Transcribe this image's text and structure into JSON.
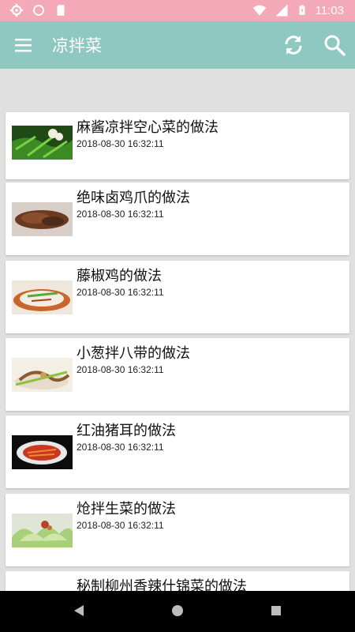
{
  "status_bar": {
    "time": "11:03",
    "icons_left": [
      "gear-icon",
      "circle-icon",
      "sd-card-icon"
    ],
    "icons_right": [
      "wifi-icon",
      "signal-icon",
      "battery-icon"
    ]
  },
  "app_bar": {
    "title": "凉拌菜",
    "icons": [
      "menu-icon",
      "refresh-icon",
      "search-icon"
    ]
  },
  "recipes": [
    {
      "title": "麻酱凉拌空心菜的做法",
      "date": "2018-08-30 16:32:11"
    },
    {
      "title": "绝味卤鸡爪的做法",
      "date": "2018-08-30 16:32:11"
    },
    {
      "title": "藤椒鸡的做法",
      "date": "2018-08-30 16:32:11"
    },
    {
      "title": "小葱拌八带的做法",
      "date": "2018-08-30 16:32:11"
    },
    {
      "title": "红油猪耳的做法",
      "date": "2018-08-30 16:32:11"
    },
    {
      "title": "炝拌生菜的做法",
      "date": "2018-08-30 16:32:11"
    },
    {
      "title": "秘制柳州香辣什锦菜的做法",
      "date": ""
    }
  ],
  "nav_bar": {
    "icons": [
      "back-icon",
      "home-icon",
      "recents-icon"
    ]
  },
  "colors": {
    "status_bar": "#f4a9b8",
    "app_bar": "#8fc8c0",
    "background": "#e0e0e0"
  }
}
